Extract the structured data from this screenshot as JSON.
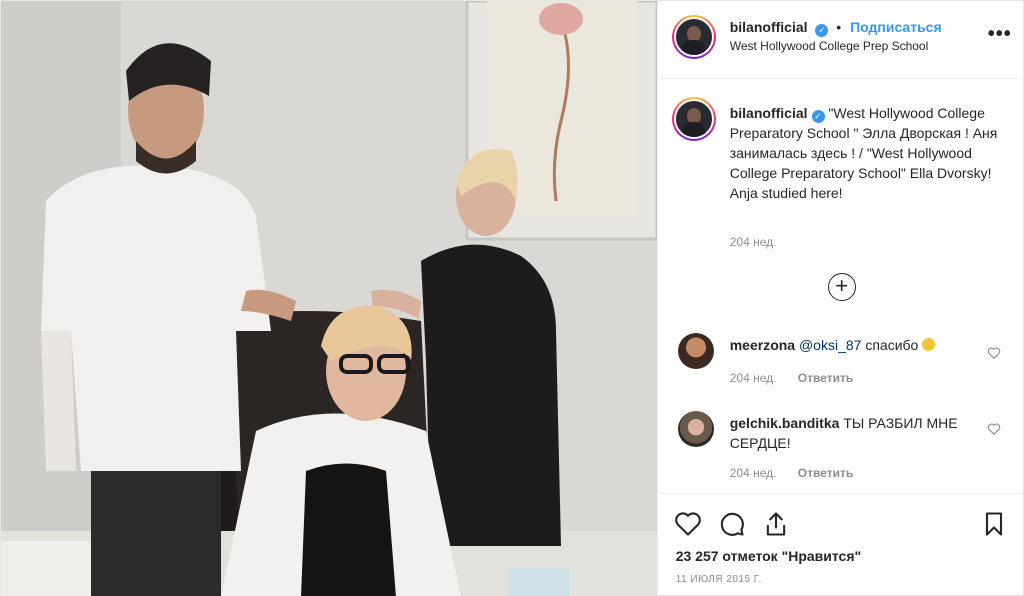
{
  "post": {
    "username": "bilanofficial",
    "verified": "✓",
    "separator": "•",
    "follow_label": "Подписаться",
    "location": "West Hollywood College Prep School",
    "more_label": "•••",
    "caption": {
      "username": "bilanofficial",
      "text": "\"West Hollywood College Preparatory School \" Элла Дворская ! Аня занималась здесь ! / \"West Hollywood College Preparatory School\" Ella Dvorsky! Anja studied here!",
      "time": "204 нед."
    },
    "load_more_label": "+",
    "comments": [
      {
        "username": "meerzona",
        "mention": "@oksi_87",
        "text": "спасибо",
        "time": "204 нед.",
        "reply_label": "Ответить"
      },
      {
        "username": "gelchik.banditka",
        "text": "ТЫ РАЗБИЛ МНЕ СЕРДЦЕ!",
        "time": "204 нед.",
        "reply_label": "Ответить"
      }
    ],
    "likes": "23 257 отметок \"Нравится\"",
    "date": "11 ИЮЛЯ 2015 Г."
  },
  "icons": {
    "like": "heart-icon",
    "comment": "comment-icon",
    "share": "share-icon",
    "save": "bookmark-icon",
    "verified": "verified-badge-icon"
  },
  "colors": {
    "accent": "#3897f0",
    "muted": "#8e8e8e",
    "text": "#262626",
    "border": "#efefef"
  }
}
